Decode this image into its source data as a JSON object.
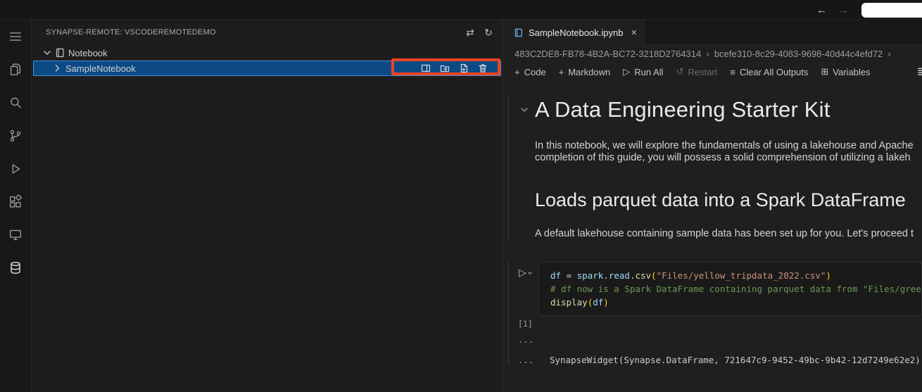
{
  "titlebar": {
    "back_label": "←",
    "forward_label": "→"
  },
  "activity_bar": {
    "items": [
      "menu",
      "explorer",
      "search",
      "source-control",
      "run-debug",
      "extensions",
      "remote-explorer",
      "synapse"
    ],
    "active_item": "synapse"
  },
  "sidebar": {
    "title": "SYNAPSE-REMOTE: VSCODEREMOTEDEMO",
    "header_icons": {
      "sync": "⇄",
      "refresh": "↻"
    },
    "tree": [
      {
        "label": "Notebook",
        "expanded": true
      },
      {
        "label": "SampleNotebook",
        "selected": true,
        "actions": [
          "open-notebook",
          "export-notebook",
          "import-notebook",
          "delete-notebook"
        ]
      }
    ]
  },
  "editor": {
    "tab": {
      "label": "SampleNotebook.ipynb",
      "close": "×"
    },
    "breadcrumbs": {
      "items": [
        "483C2DE8-FB78-4B2A-BC72-3218D2764314",
        "bcefe310-8c29-4083-9698-40d44c4efd72"
      ],
      "separator": "›"
    },
    "toolbar": {
      "items": [
        {
          "icon": "+",
          "label": "Code",
          "disabled": false
        },
        {
          "icon": "+",
          "label": "Markdown",
          "disabled": false
        },
        {
          "icon": "▷",
          "label": "Run All",
          "disabled": false
        },
        {
          "icon": "↺",
          "label": "Restart",
          "disabled": true
        },
        {
          "icon": "≡",
          "label": "Clear All Outputs",
          "disabled": false
        },
        {
          "icon": "⊞",
          "label": "Variables",
          "disabled": false
        }
      ],
      "overflow_icon": "≣"
    },
    "markdown_cell": {
      "heading1": "A Data Engineering Starter Kit",
      "paragraph_line1": "In this notebook, we will explore the fundamentals of using a lakehouse and Apache",
      "paragraph_line2": "completion of this guide, you will possess a solid comprehension of utilizing a lakeh",
      "heading2": "Loads parquet data into a Spark DataFrame",
      "paragraph2": "A default lakehouse containing sample data has been set up for you. Let's proceed t"
    },
    "code_cell": {
      "run_icon": "▷",
      "execution_count": "[1]",
      "lines": [
        [
          [
            "df",
            "v"
          ],
          [
            " ",
            "p"
          ],
          [
            "=",
            "p"
          ],
          [
            " ",
            "p"
          ],
          [
            "spark",
            "v"
          ],
          [
            ".",
            "p"
          ],
          [
            "read",
            "v"
          ],
          [
            ".",
            "p"
          ],
          [
            "csv",
            "f"
          ],
          [
            "(",
            "b"
          ],
          [
            "\"Files/yellow_tripdata_2022.csv\"",
            "s"
          ],
          [
            ")",
            "b"
          ]
        ],
        [
          [
            "# df now is a Spark DataFrame containing parquet data from \"Files/green_",
            "c"
          ]
        ],
        [
          [
            "display",
            "f"
          ],
          [
            "(",
            "b"
          ],
          [
            "df",
            "v"
          ],
          [
            ")",
            "b"
          ]
        ]
      ]
    },
    "output": {
      "indicator1": "...",
      "indicator2": "...",
      "text": "SynapseWidget(Synapse.DataFrame, 721647c9-9452-49bc-9b42-12d7249e62e2)"
    }
  },
  "annotation": {
    "highlight_color": "#ee4223"
  },
  "colors": {
    "selection_background": "#0d4a85",
    "selection_border": "#3d8fd6",
    "accent_blue": "#0078d4",
    "syntax": {
      "variable": "#9cdcfe",
      "function": "#dcdcaa",
      "string": "#ce9178",
      "comment": "#6a9955",
      "bracket": "#ffd700",
      "plain": "#d4d4d4"
    }
  }
}
